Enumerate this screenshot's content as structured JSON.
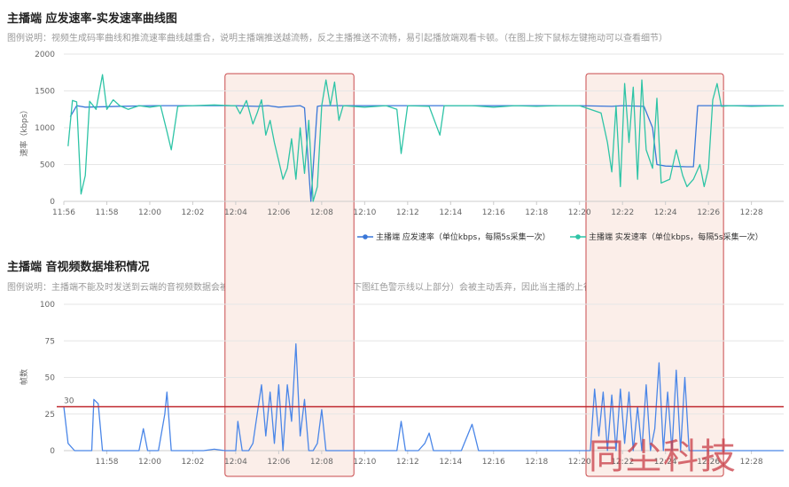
{
  "chart1": {
    "title": "主播端 应发速率-实发速率曲线图",
    "desc": "图例说明：视频生成码率曲线和推流速率曲线越重合，说明主播端推送越流畅，反之主播推送不流畅，易引起播放端观看卡顿。（在图上按下鼠标左键拖动可以查看细节）",
    "ylabel": "速率（kbps）",
    "legend": [
      "主播端 应发速率（单位kbps，每隔5s采集一次）",
      "主播端 实发速率（单位kbps，每隔5s采集一次）"
    ]
  },
  "chart2": {
    "title": "主播端 音视频数据堆积情况",
    "desc": "图例说明：主播端不能及时发送到云端的音视频数据会被堆积起来，数据堆积超过三秒（下图红色警示线以上部分）会被主动丢弃，因此当主播的上行网络不理想时，观看端会出现",
    "ylabel": "帧数",
    "threshold_label": "30"
  },
  "watermark": "同尘科技",
  "colors": {
    "planned": "#3a77d8",
    "actual": "#2ec4a6",
    "stack": "#4a86e8",
    "threshold": "#c0282e",
    "highlight_fill": "#fbeee9",
    "highlight_border": "#c9494c"
  },
  "chart_data": [
    {
      "type": "line",
      "title": "主播端 应发速率-实发速率曲线图",
      "ylabel": "速率（kbps）",
      "x_ticks": [
        "11:56",
        "11:58",
        "12:00",
        "12:02",
        "12:04",
        "12:06",
        "12:08",
        "12:10",
        "12:12",
        "12:14",
        "12:16",
        "12:18",
        "12:20",
        "12:22",
        "12:24",
        "12:26",
        "12:28"
      ],
      "y_ticks": [
        0,
        500,
        1000,
        1500,
        2000
      ],
      "ylim": [
        0,
        2000
      ],
      "xlim_minutes": [
        "11:56",
        "12:29.5"
      ],
      "grid": "horizontal",
      "legend_position": "bottom-right",
      "highlight_ranges": [
        [
          "12:03.5",
          "12:09.5"
        ],
        [
          "12:20.3",
          "12:26.7"
        ]
      ],
      "series": [
        {
          "name": "主播端 应发速率（单位kbps，每隔5s采集一次）",
          "key": "planned",
          "points": [
            [
              "11:56.3",
              1150
            ],
            [
              "11:56.6",
              1300
            ],
            [
              "11:57",
              1280
            ],
            [
              "12:00",
              1300
            ],
            [
              "12:04",
              1300
            ],
            [
              "12:05",
              1290
            ],
            [
              "12:05.5",
              1300
            ],
            [
              "12:06",
              1280
            ],
            [
              "12:07",
              1300
            ],
            [
              "12:07.2",
              1270
            ],
            [
              "12:07.5",
              0
            ],
            [
              "12:07.8",
              1290
            ],
            [
              "12:08",
              1300
            ],
            [
              "12:12",
              1300
            ],
            [
              "12:16",
              1300
            ],
            [
              "12:20",
              1300
            ],
            [
              "12:21.5",
              1290
            ],
            [
              "12:22",
              1300
            ],
            [
              "12:23",
              1290
            ],
            [
              "12:23.4",
              1000
            ],
            [
              "12:23.6",
              500
            ],
            [
              "12:24",
              480
            ],
            [
              "12:25",
              470
            ],
            [
              "12:25.3",
              470
            ],
            [
              "12:25.5",
              1300
            ],
            [
              "12:26",
              1300
            ],
            [
              "12:29.5",
              1300
            ]
          ]
        },
        {
          "name": "主播端 实发速率（单位kbps，每隔5s采集一次）",
          "key": "actual",
          "points": [
            [
              "11:56.2",
              750
            ],
            [
              "11:56.4",
              1370
            ],
            [
              "11:56.6",
              1350
            ],
            [
              "11:56.8",
              100
            ],
            [
              "11:57",
              350
            ],
            [
              "11:57.2",
              1360
            ],
            [
              "11:57.5",
              1250
            ],
            [
              "11:57.8",
              1720
            ],
            [
              "11:58",
              1250
            ],
            [
              "11:58.3",
              1380
            ],
            [
              "11:58.6",
              1300
            ],
            [
              "11:59",
              1250
            ],
            [
              "11:59.5",
              1300
            ],
            [
              "12:00",
              1280
            ],
            [
              "12:00.5",
              1300
            ],
            [
              "12:00.8",
              950
            ],
            [
              "12:01",
              700
            ],
            [
              "12:01.3",
              1290
            ],
            [
              "12:02",
              1300
            ],
            [
              "12:03",
              1310
            ],
            [
              "12:03.8",
              1300
            ],
            [
              "12:04",
              1300
            ],
            [
              "12:04.2",
              1190
            ],
            [
              "12:04.5",
              1370
            ],
            [
              "12:04.8",
              1050
            ],
            [
              "12:05",
              1200
            ],
            [
              "12:05.2",
              1380
            ],
            [
              "12:05.4",
              900
            ],
            [
              "12:05.6",
              1100
            ],
            [
              "12:05.8",
              800
            ],
            [
              "12:06",
              550
            ],
            [
              "12:06.2",
              300
            ],
            [
              "12:06.4",
              450
            ],
            [
              "12:06.6",
              850
            ],
            [
              "12:06.8",
              300
            ],
            [
              "12:07",
              1000
            ],
            [
              "12:07.2",
              380
            ],
            [
              "12:07.4",
              1100
            ],
            [
              "12:07.6",
              0
            ],
            [
              "12:07.8",
              200
            ],
            [
              "12:08",
              1300
            ],
            [
              "12:08.2",
              1650
            ],
            [
              "12:08.4",
              1300
            ],
            [
              "12:08.6",
              1620
            ],
            [
              "12:08.8",
              1100
            ],
            [
              "12:09",
              1300
            ],
            [
              "12:10",
              1280
            ],
            [
              "12:11",
              1300
            ],
            [
              "12:11.5",
              1250
            ],
            [
              "12:11.7",
              650
            ],
            [
              "12:12",
              1300
            ],
            [
              "12:13",
              1290
            ],
            [
              "12:13.5",
              900
            ],
            [
              "12:13.7",
              1300
            ],
            [
              "12:15",
              1300
            ],
            [
              "12:16",
              1280
            ],
            [
              "12:17",
              1300
            ],
            [
              "12:18",
              1290
            ],
            [
              "12:19",
              1300
            ],
            [
              "12:20",
              1300
            ],
            [
              "12:21",
              1200
            ],
            [
              "12:21.3",
              800
            ],
            [
              "12:21.5",
              400
            ],
            [
              "12:21.7",
              1300
            ],
            [
              "12:21.9",
              200
            ],
            [
              "12:22.1",
              1600
            ],
            [
              "12:22.3",
              800
            ],
            [
              "12:22.5",
              1550
            ],
            [
              "12:22.7",
              300
            ],
            [
              "12:22.9",
              1650
            ],
            [
              "12:23.1",
              700
            ],
            [
              "12:23.4",
              450
            ],
            [
              "12:23.6",
              1400
            ],
            [
              "12:23.8",
              250
            ],
            [
              "12:24.2",
              300
            ],
            [
              "12:24.5",
              700
            ],
            [
              "12:24.8",
              350
            ],
            [
              "12:25",
              200
            ],
            [
              "12:25.3",
              300
            ],
            [
              "12:25.6",
              500
            ],
            [
              "12:25.8",
              200
            ],
            [
              "12:26",
              450
            ],
            [
              "12:26.2",
              1380
            ],
            [
              "12:26.4",
              1600
            ],
            [
              "12:26.6",
              1290
            ],
            [
              "12:27",
              1300
            ],
            [
              "12:28",
              1290
            ],
            [
              "12:29.5",
              1300
            ]
          ]
        }
      ]
    },
    {
      "type": "line",
      "title": "主播端 音视频数据堆积情况",
      "ylabel": "帧数",
      "x_ticks": [
        "11:58",
        "12:00",
        "12:02",
        "12:04",
        "12:06",
        "12:08",
        "12:10",
        "12:12",
        "12:14",
        "12:16",
        "12:18",
        "12:20",
        "12:22",
        "12:24",
        "12:26",
        "12:28"
      ],
      "y_ticks": [
        0,
        25,
        50,
        75,
        100
      ],
      "ylim": [
        0,
        100
      ],
      "threshold": 30,
      "grid": "horizontal",
      "series": [
        {
          "name": "",
          "key": "stack",
          "points": [
            [
              "11:56",
              30
            ],
            [
              "11:56.2",
              5
            ],
            [
              "11:56.5",
              0
            ],
            [
              "11:57",
              0
            ],
            [
              "11:57.3",
              0
            ],
            [
              "11:57.4",
              35
            ],
            [
              "11:57.6",
              32
            ],
            [
              "11:57.8",
              0
            ],
            [
              "11:58.5",
              0
            ],
            [
              "11:59.5",
              0
            ],
            [
              "11:59.7",
              15
            ],
            [
              "11:59.9",
              0
            ],
            [
              "12:00.4",
              0
            ],
            [
              "12:00.7",
              25
            ],
            [
              "12:00.8",
              40
            ],
            [
              "12:01",
              0
            ],
            [
              "12:01.3",
              0
            ],
            [
              "12:01.6",
              0
            ],
            [
              "12:02",
              0
            ],
            [
              "12:02.5",
              0
            ],
            [
              "12:03",
              1
            ],
            [
              "12:03.5",
              0
            ],
            [
              "12:04",
              0
            ],
            [
              "12:04.1",
              20
            ],
            [
              "12:04.3",
              0
            ],
            [
              "12:04.6",
              0
            ],
            [
              "12:04.8",
              5
            ],
            [
              "12:05",
              25
            ],
            [
              "12:05.2",
              45
            ],
            [
              "12:05.4",
              10
            ],
            [
              "12:05.6",
              40
            ],
            [
              "12:05.8",
              5
            ],
            [
              "12:06",
              45
            ],
            [
              "12:06.2",
              0
            ],
            [
              "12:06.4",
              45
            ],
            [
              "12:06.6",
              20
            ],
            [
              "12:06.8",
              73
            ],
            [
              "12:07",
              10
            ],
            [
              "12:07.2",
              35
            ],
            [
              "12:07.4",
              0
            ],
            [
              "12:07.6",
              0
            ],
            [
              "12:07.8",
              5
            ],
            [
              "12:08",
              28
            ],
            [
              "12:08.2",
              0
            ],
            [
              "12:09",
              0
            ],
            [
              "12:10",
              0
            ],
            [
              "12:11",
              0
            ],
            [
              "12:11.5",
              0
            ],
            [
              "12:11.7",
              20
            ],
            [
              "12:11.9",
              0
            ],
            [
              "12:12.5",
              0
            ],
            [
              "12:12.8",
              5
            ],
            [
              "12:13",
              12
            ],
            [
              "12:13.2",
              0
            ],
            [
              "12:14",
              0
            ],
            [
              "12:14.5",
              0
            ],
            [
              "12:15",
              18
            ],
            [
              "12:15.3",
              0
            ],
            [
              "12:16",
              0
            ],
            [
              "12:17",
              0
            ],
            [
              "12:18",
              0
            ],
            [
              "12:19",
              0
            ],
            [
              "12:20",
              0
            ],
            [
              "12:20.5",
              0
            ],
            [
              "12:20.7",
              42
            ],
            [
              "12:20.9",
              10
            ],
            [
              "12:21.1",
              40
            ],
            [
              "12:21.3",
              0
            ],
            [
              "12:21.5",
              38
            ],
            [
              "12:21.7",
              0
            ],
            [
              "12:21.9",
              42
            ],
            [
              "12:22.1",
              5
            ],
            [
              "12:22.3",
              40
            ],
            [
              "12:22.5",
              0
            ],
            [
              "12:22.7",
              30
            ],
            [
              "12:22.9",
              0
            ],
            [
              "12:23.1",
              45
            ],
            [
              "12:23.3",
              0
            ],
            [
              "12:23.5",
              15
            ],
            [
              "12:23.7",
              60
            ],
            [
              "12:23.9",
              0
            ],
            [
              "12:24.1",
              40
            ],
            [
              "12:24.3",
              0
            ],
            [
              "12:24.5",
              55
            ],
            [
              "12:24.7",
              0
            ],
            [
              "12:24.9",
              50
            ],
            [
              "12:25.1",
              0
            ],
            [
              "12:25.5",
              0
            ],
            [
              "12:26",
              0
            ],
            [
              "12:28",
              0
            ],
            [
              "12:29.5",
              0
            ]
          ]
        }
      ]
    }
  ]
}
